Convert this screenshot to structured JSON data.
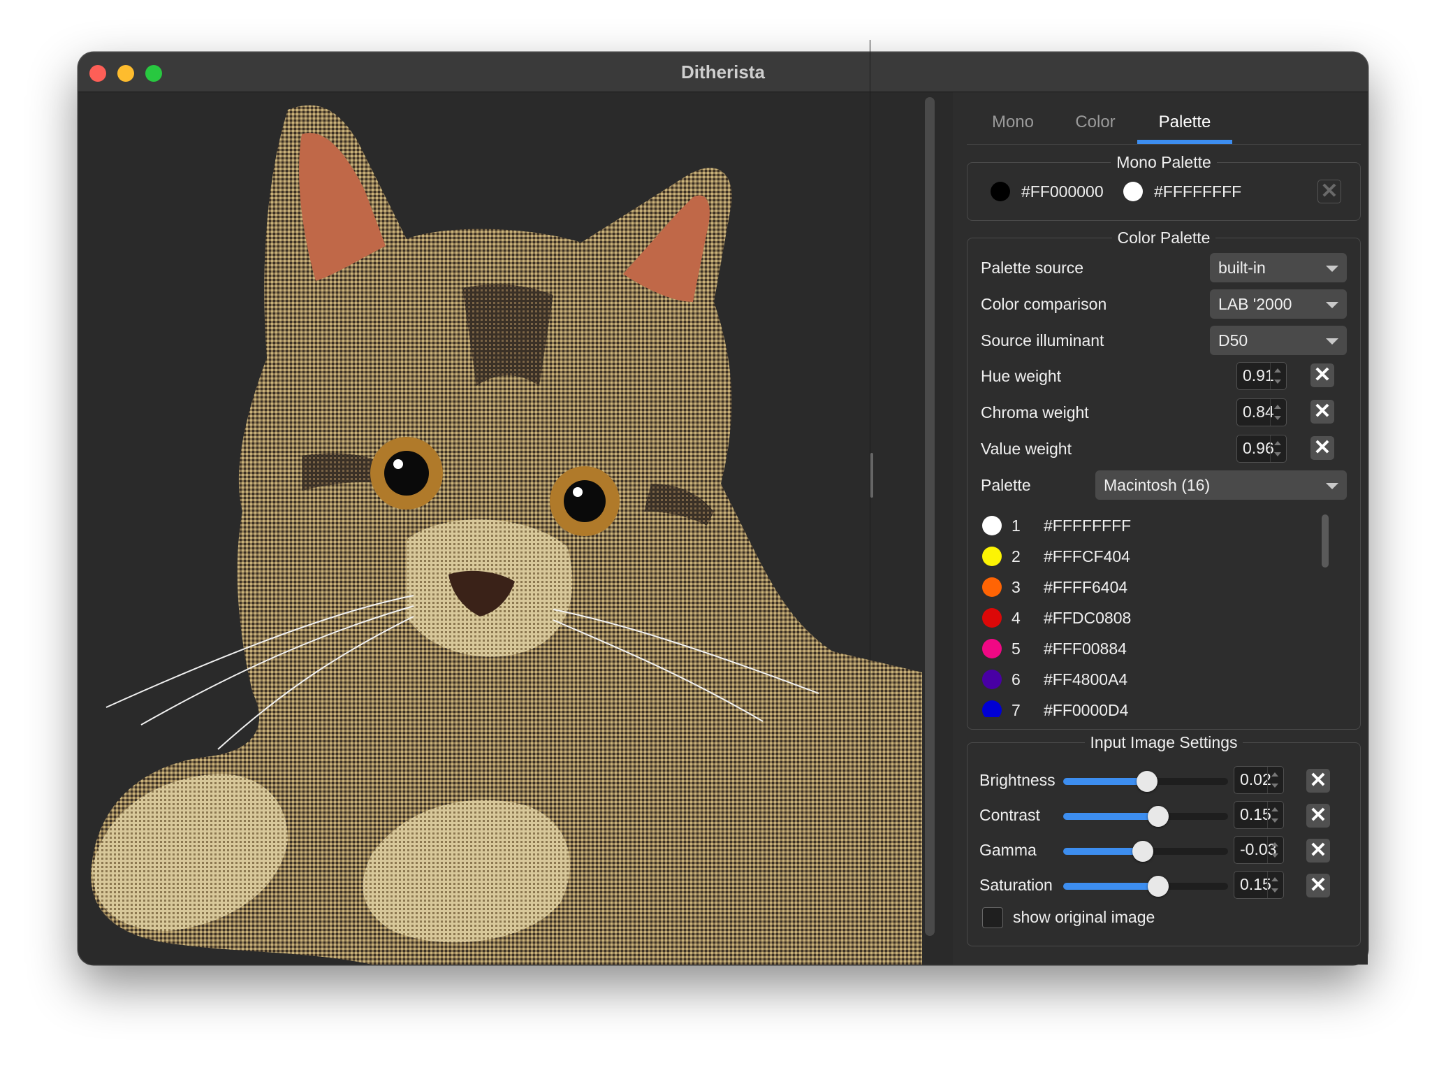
{
  "window": {
    "title": "Ditherista"
  },
  "tabs": [
    {
      "label": "Mono",
      "active": false
    },
    {
      "label": "Color",
      "active": false
    },
    {
      "label": "Palette",
      "active": true
    }
  ],
  "mono_palette": {
    "title": "Mono Palette",
    "colors": [
      {
        "hex": "#FF000000",
        "swatch": "#000000"
      },
      {
        "hex": "#FFFFFFFF",
        "swatch": "#ffffff"
      }
    ]
  },
  "color_palette": {
    "title": "Color Palette",
    "palette_source": {
      "label": "Palette source",
      "value": "built-in"
    },
    "color_comparison": {
      "label": "Color comparison",
      "value": "LAB '2000"
    },
    "source_illuminant": {
      "label": "Source illuminant",
      "value": "D50"
    },
    "hue_weight": {
      "label": "Hue weight",
      "value": "0.91"
    },
    "chroma_weight": {
      "label": "Chroma weight",
      "value": "0.84"
    },
    "value_weight": {
      "label": "Value weight",
      "value": "0.96"
    },
    "palette": {
      "label": "Palette",
      "value": "Macintosh (16)"
    },
    "entries": [
      {
        "index": "1",
        "hex": "#FFFFFFFF",
        "swatch": "#ffffff"
      },
      {
        "index": "2",
        "hex": "#FFFCF404",
        "swatch": "#fcf404"
      },
      {
        "index": "3",
        "hex": "#FFFF6404",
        "swatch": "#ff6404"
      },
      {
        "index": "4",
        "hex": "#FFDC0808",
        "swatch": "#dc0808"
      },
      {
        "index": "5",
        "hex": "#FFF00884",
        "swatch": "#f00884"
      },
      {
        "index": "6",
        "hex": "#FF4800A4",
        "swatch": "#4800a4"
      },
      {
        "index": "7",
        "hex": "#FF0000D4",
        "swatch": "#0000d4"
      }
    ]
  },
  "input_settings": {
    "title": "Input Image Settings",
    "sliders": [
      {
        "label": "Brightness",
        "value": "0.02",
        "level": 0.51
      },
      {
        "label": "Contrast",
        "value": "0.15",
        "level": 0.575
      },
      {
        "label": "Gamma",
        "value": "-0.03",
        "level": 0.485
      },
      {
        "label": "Saturation",
        "value": "0.15",
        "level": 0.575
      }
    ],
    "show_original": {
      "label": "show original image",
      "checked": false
    }
  },
  "colors": {
    "accent": "#3d8ef0",
    "window_bg": "#2a2a2a",
    "panel_bg": "#2d2d2d"
  }
}
